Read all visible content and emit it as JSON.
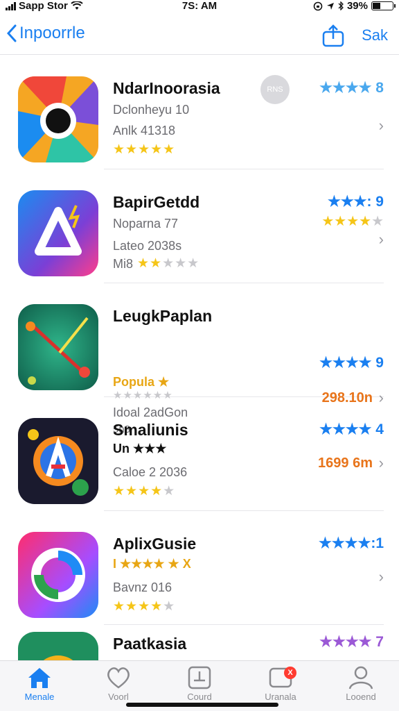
{
  "status": {
    "carrier": "Sapp Stor",
    "time": "7S: AM",
    "battery": "39%",
    "battery_level": 0.39
  },
  "nav": {
    "back_label": "Inpoorrle",
    "right_label": "Sak"
  },
  "apps": [
    {
      "name": "NdarInoorasia",
      "line1": "Dclonheyu 10",
      "line2": "Anlk 41318",
      "stars_left": "★★★★★",
      "rating_right": "★★★★ 8",
      "get_label": "RNS",
      "icon_colors": [
        "#f0473a",
        "#f5a623",
        "#2ec4a6",
        "#7b4fd8"
      ]
    },
    {
      "name": "BapirGetdd",
      "line1": "Noparna 77",
      "line2": "Lateo 2038s",
      "line3": "Mi8",
      "stars_left": "★★★★",
      "rating_right": "★★★: 9",
      "stars_right": "★★★★★",
      "icon_colors": [
        "#1b8cf0",
        "#7b3fd6",
        "#ff3d8b"
      ]
    },
    {
      "name": "LeugkPaplan",
      "line1": "Popula ★",
      "line2": "★★★★★★",
      "line3": "Idoal 2adGon",
      "line4": "5n8",
      "rating_right": "★★★★ 9",
      "sub_right": "298.10n",
      "icon_colors": [
        "#1f9a6e",
        "#0f5e4a"
      ]
    },
    {
      "name": "Smaliunis",
      "line1": "Un ★★★",
      "line2": "Caloe 2 2036",
      "stars_left": "★★★★★",
      "rating_right": "★★★★ 4",
      "sub_right": "1699 6m",
      "icon_colors": [
        "#1a1a2e",
        "#f58a1f",
        "#2b74e6"
      ]
    },
    {
      "name": "AplixGusie",
      "line1": "I ★★★★ ★ X",
      "line2": "Bavnz 016",
      "stars_left": "★★★★★",
      "rating_right": "★★★★:1",
      "icon_colors": [
        "#ff2d6d",
        "#a64dff",
        "#1f8bf5"
      ]
    },
    {
      "name": "Paatkasia",
      "rating_right": "★★★★ 7",
      "icon_colors": [
        "#1f8f5e",
        "#f5b11a"
      ]
    }
  ],
  "colors": {
    "accent": "#1a7ff0",
    "star": "#f5c518",
    "purple_star": "#9b59d6",
    "orange": "#e8741a"
  },
  "tabs": [
    {
      "label": "Menale",
      "icon": "home-icon",
      "active": true
    },
    {
      "label": "Voorl",
      "icon": "heart-icon"
    },
    {
      "label": "Courd",
      "icon": "document-icon"
    },
    {
      "label": "Uranala",
      "icon": "message-icon",
      "badge": "X"
    },
    {
      "label": "Looend",
      "icon": "person-icon"
    }
  ]
}
